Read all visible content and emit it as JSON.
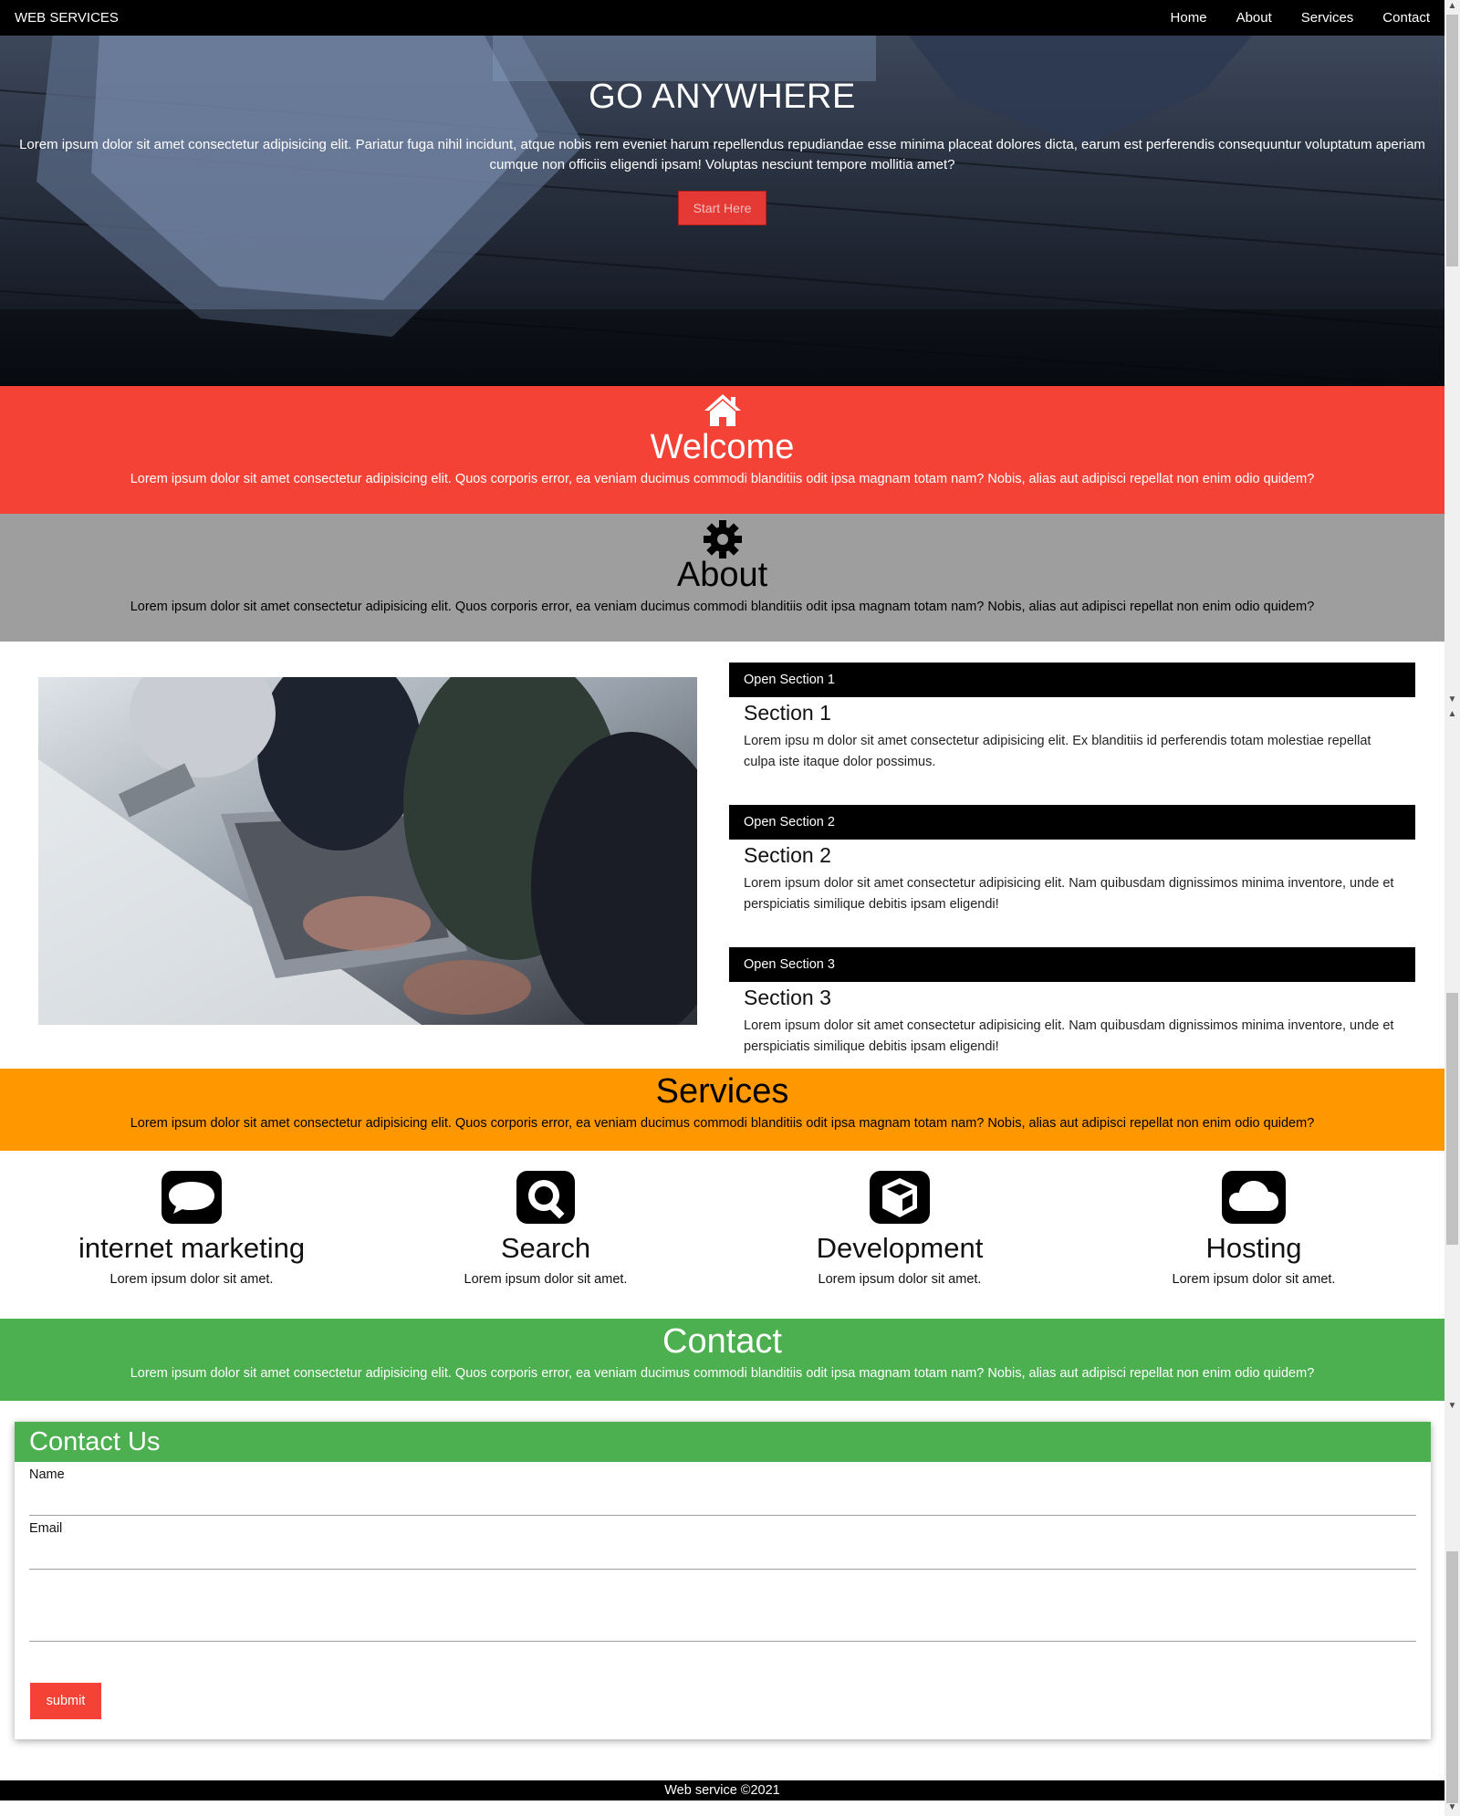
{
  "nav": {
    "brand": "WEB SERVICES",
    "links": [
      "Home",
      "About",
      "Services",
      "Contact"
    ]
  },
  "hero": {
    "title": "GO ANYWHERE",
    "text": "Lorem ipsum dolor sit amet consectetur adipisicing elit. Pariatur fuga nihil incidunt, atque nobis rem eveniet harum repellendus repudiandae esse minima placeat dolores dicta, earum est perferendis consequuntur voluptatum aperiam cumque non officiis eligendi ipsam! Voluptas nesciunt tempore mollitia amet?",
    "button": "Start Here"
  },
  "welcome": {
    "icon": "home-icon",
    "title": "Welcome",
    "text": "Lorem ipsum dolor sit amet consectetur adipisicing elit. Quos corporis error, ea veniam ducimus commodi blanditiis odit ipsa magnam totam nam? Nobis, alias aut adipisci repellat non enim odio quidem?"
  },
  "about": {
    "icon": "gear-icon",
    "title": "About",
    "text": "Lorem ipsum dolor sit amet consectetur adipisicing elit. Quos corporis error, ea veniam ducimus commodi blanditiis odit ipsa magnam totam nam? Nobis, alias aut adipisci repellat non enim odio quidem?",
    "sections": [
      {
        "header": "Open Section 1",
        "title": "Section 1",
        "text": "Lorem ipsu m dolor sit amet consectetur adipisicing elit. Ex blanditiis id perferendis totam molestiae repellat culpa iste itaque dolor possimus."
      },
      {
        "header": "Open Section 2",
        "title": "Section 2",
        "text": "Lorem ipsum dolor sit amet consectetur adipisicing elit. Nam quibusdam dignissimos minima inventore, unde et perspiciatis similique debitis ipsam eligendi!"
      },
      {
        "header": "Open Section 3",
        "title": "Section 3",
        "text": "Lorem ipsum dolor sit amet consectetur adipisicing elit. Nam quibusdam dignissimos minima inventore, unde et perspiciatis similique debitis ipsam eligendi!"
      }
    ]
  },
  "services": {
    "title": "Services",
    "text": "Lorem ipsum dolor sit amet consectetur adipisicing elit. Quos corporis error, ea veniam ducimus commodi blanditiis odit ipsa magnam totam nam? Nobis, alias aut adipisci repellat non enim odio quidem?",
    "items": [
      {
        "icon": "comment-icon",
        "title": "internet marketing",
        "text": "Lorem ipsum dolor sit amet."
      },
      {
        "icon": "search-icon",
        "title": "Search",
        "text": "Lorem ipsum dolor sit amet."
      },
      {
        "icon": "cube-icon",
        "title": "Development",
        "text": "Lorem ipsum dolor sit amet."
      },
      {
        "icon": "cloud-icon",
        "title": "Hosting",
        "text": "Lorem ipsum dolor sit amet."
      }
    ]
  },
  "contact": {
    "title": "Contact",
    "text": "Lorem ipsum dolor sit amet consectetur adipisicing elit. Quos corporis error, ea veniam ducimus commodi blanditiis odit ipsa magnam totam nam? Nobis, alias aut adipisci repellat non enim odio quidem?",
    "form_title": "Contact Us",
    "name_label": "Name",
    "email_label": "Email",
    "name_value": "",
    "email_value": "",
    "message_value": "",
    "submit": "submit"
  },
  "footer": {
    "text": "Web service ©2021"
  },
  "colors": {
    "red": "#f44336",
    "grey": "#9e9e9e",
    "orange": "#ff9800",
    "green": "#4caf50",
    "black": "#000000"
  }
}
